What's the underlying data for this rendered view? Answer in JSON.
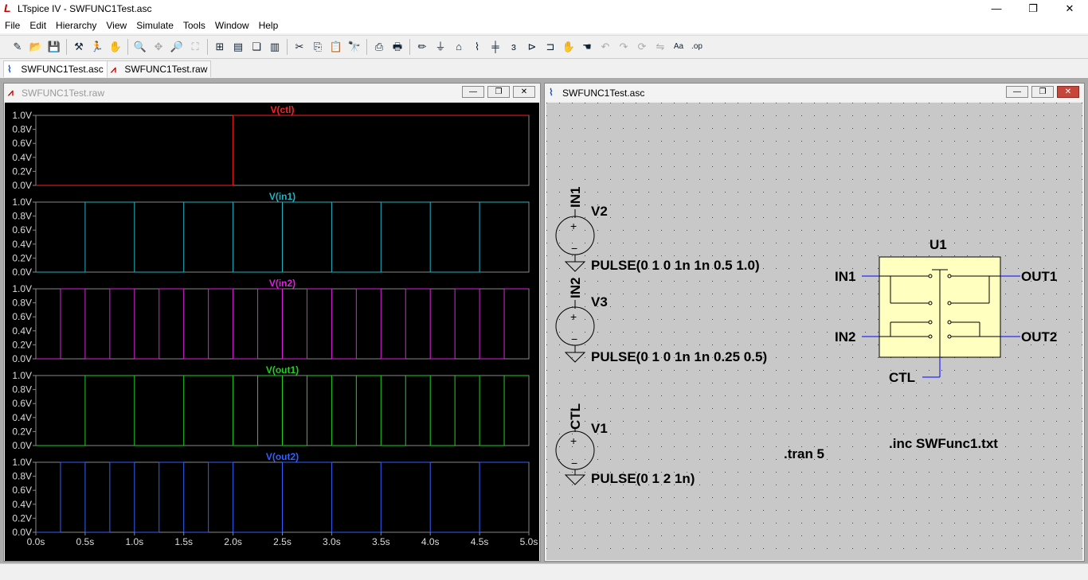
{
  "window": {
    "title": "LTspice IV - SWFUNC1Test.asc",
    "app_glyph": "L",
    "min": "—",
    "max": "❐",
    "close": "✕"
  },
  "menu": [
    "File",
    "Edit",
    "Hierarchy",
    "View",
    "Simulate",
    "Tools",
    "Window",
    "Help"
  ],
  "toolbar_icons": [
    "new-schematic",
    "open",
    "save",
    "control-panel",
    "run",
    "halt",
    "zoom-in",
    "pan",
    "zoom-out",
    "zoom-fit",
    "autorange",
    "tile-horizontal",
    "cascade",
    "tile-vertical",
    "cut",
    "copy",
    "paste",
    "find",
    "print-preview",
    "print",
    "draw-wire",
    "ground",
    "label-net",
    "resistor",
    "capacitor",
    "inductor",
    "diode",
    "component",
    "move",
    "drag",
    "undo",
    "redo",
    "rotate",
    "mirror",
    "text",
    "spice-directive"
  ],
  "tabs": [
    {
      "label": "SWFUNC1Test.asc",
      "active": true,
      "icon": "schematic-icon"
    },
    {
      "label": "SWFUNC1Test.raw",
      "active": false,
      "icon": "waveform-icon"
    }
  ],
  "waveform_window": {
    "title": "SWFUNC1Test.raw"
  },
  "schematic_window": {
    "title": "SWFUNC1Test.asc"
  },
  "chart_data": {
    "type": "line",
    "xlabel": "",
    "xlim": [
      0,
      5
    ],
    "x_ticks": [
      "0.0s",
      "0.5s",
      "1.0s",
      "1.5s",
      "2.0s",
      "2.5s",
      "3.0s",
      "3.5s",
      "4.0s",
      "4.5s",
      "5.0s"
    ],
    "y_ticks": [
      "1.0V",
      "0.8V",
      "0.6V",
      "0.4V",
      "0.2V",
      "0.0V"
    ],
    "ylim": [
      0,
      1
    ],
    "background": "#000000",
    "series": [
      {
        "name": "V(ctl)",
        "color": "#ff2020",
        "transitions": [
          2.0
        ],
        "initial": 0
      },
      {
        "name": "V(in1)",
        "color": "#1fb5c5",
        "transitions": [
          0.5,
          1.0,
          1.5,
          2.0,
          2.5,
          3.0,
          3.5,
          4.0,
          4.5
        ],
        "initial": 0
      },
      {
        "name": "V(in2)",
        "color": "#e020e0",
        "transitions": [
          0.25,
          0.5,
          0.75,
          1.0,
          1.25,
          1.5,
          1.75,
          2.0,
          2.25,
          2.5,
          2.75,
          3.0,
          3.25,
          3.5,
          3.75,
          4.0,
          4.25,
          4.5,
          4.75
        ],
        "initial": 0
      },
      {
        "name": "V(out1)",
        "color": "#20d020",
        "transitions": [
          0.5,
          1.0,
          1.5,
          2.0,
          2.25,
          2.5,
          2.75,
          3.0,
          3.25,
          3.5,
          3.75,
          4.0,
          4.25,
          4.5,
          4.75
        ],
        "initial": 0
      },
      {
        "name": "V(out2)",
        "color": "#3060ff",
        "transitions": [
          0.25,
          0.5,
          0.75,
          1.0,
          1.25,
          1.5,
          1.75,
          2.0,
          2.5,
          3.0,
          3.5,
          4.0,
          4.5
        ],
        "initial": 0
      }
    ]
  },
  "schematic": {
    "sources": [
      {
        "net": "IN1",
        "name": "V2",
        "value": "PULSE(0 1 0 1n 1n 0.5 1.0)"
      },
      {
        "net": "IN2",
        "name": "V3",
        "value": "PULSE(0 1 0 1n 1n 0.25 0.5)"
      },
      {
        "net": "CTL",
        "name": "V1",
        "value": "PULSE(0 1 2 1n)"
      }
    ],
    "component": {
      "ref": "U1",
      "pins": {
        "in1": "IN1",
        "in2": "IN2",
        "out1": "OUT1",
        "out2": "OUT2",
        "ctl": "CTL"
      },
      "fill": "#ffffc0"
    },
    "directives": [
      ".tran 5",
      ".inc SWFunc1.txt"
    ],
    "background": "#c8c8c8"
  }
}
